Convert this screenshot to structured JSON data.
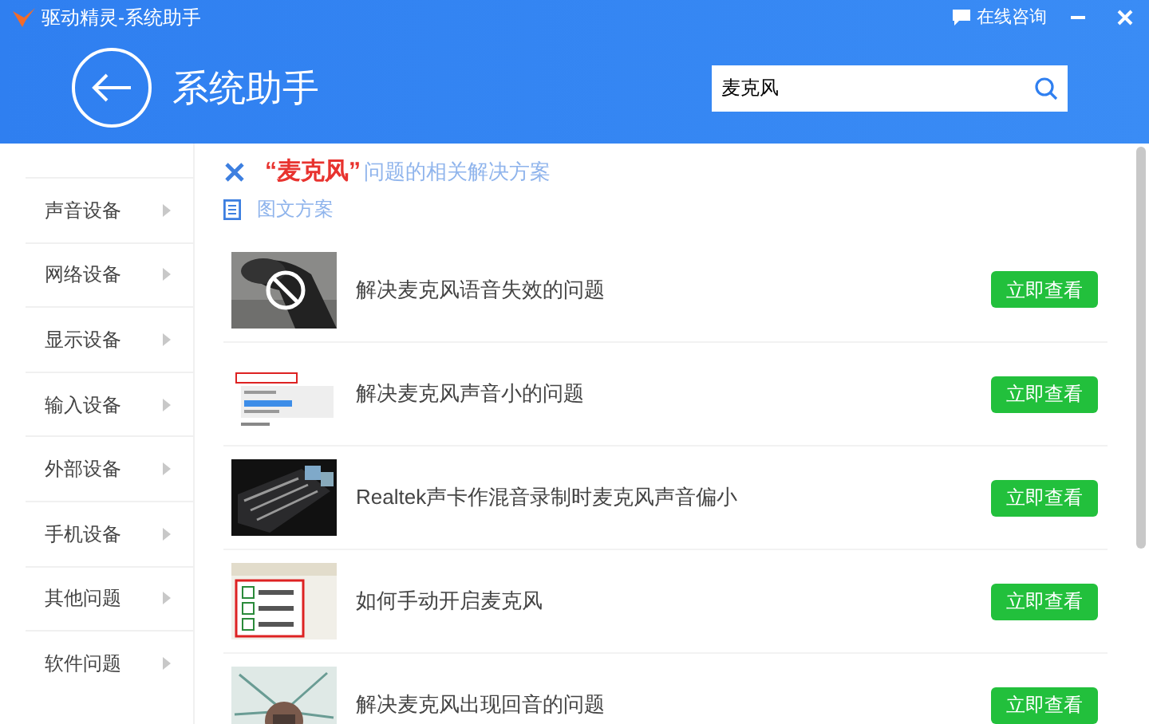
{
  "window": {
    "title": "驱动精灵-系统助手",
    "consult": "在线咨询"
  },
  "header": {
    "title": "系统助手"
  },
  "search": {
    "value": "麦克风"
  },
  "sidebar": {
    "items": [
      {
        "label": "声音设备"
      },
      {
        "label": "网络设备"
      },
      {
        "label": "显示设备"
      },
      {
        "label": "输入设备"
      },
      {
        "label": "外部设备"
      },
      {
        "label": "手机设备"
      },
      {
        "label": "其他问题"
      },
      {
        "label": "软件问题"
      }
    ]
  },
  "results": {
    "keyword": "“麦克风”",
    "heading": "问题的相关解决方案",
    "section": "图文方案",
    "items": [
      {
        "title": "解决麦克风语音失效的问题",
        "button": "立即查看"
      },
      {
        "title": "解决麦克风声音小的问题",
        "button": "立即查看"
      },
      {
        "title": "Realtek声卡作混音录制时麦克风声音偏小",
        "button": "立即查看"
      },
      {
        "title": "如何手动开启麦克风",
        "button": "立即查看"
      },
      {
        "title": "解决麦克风出现回音的问题",
        "button": "立即查看"
      }
    ]
  }
}
